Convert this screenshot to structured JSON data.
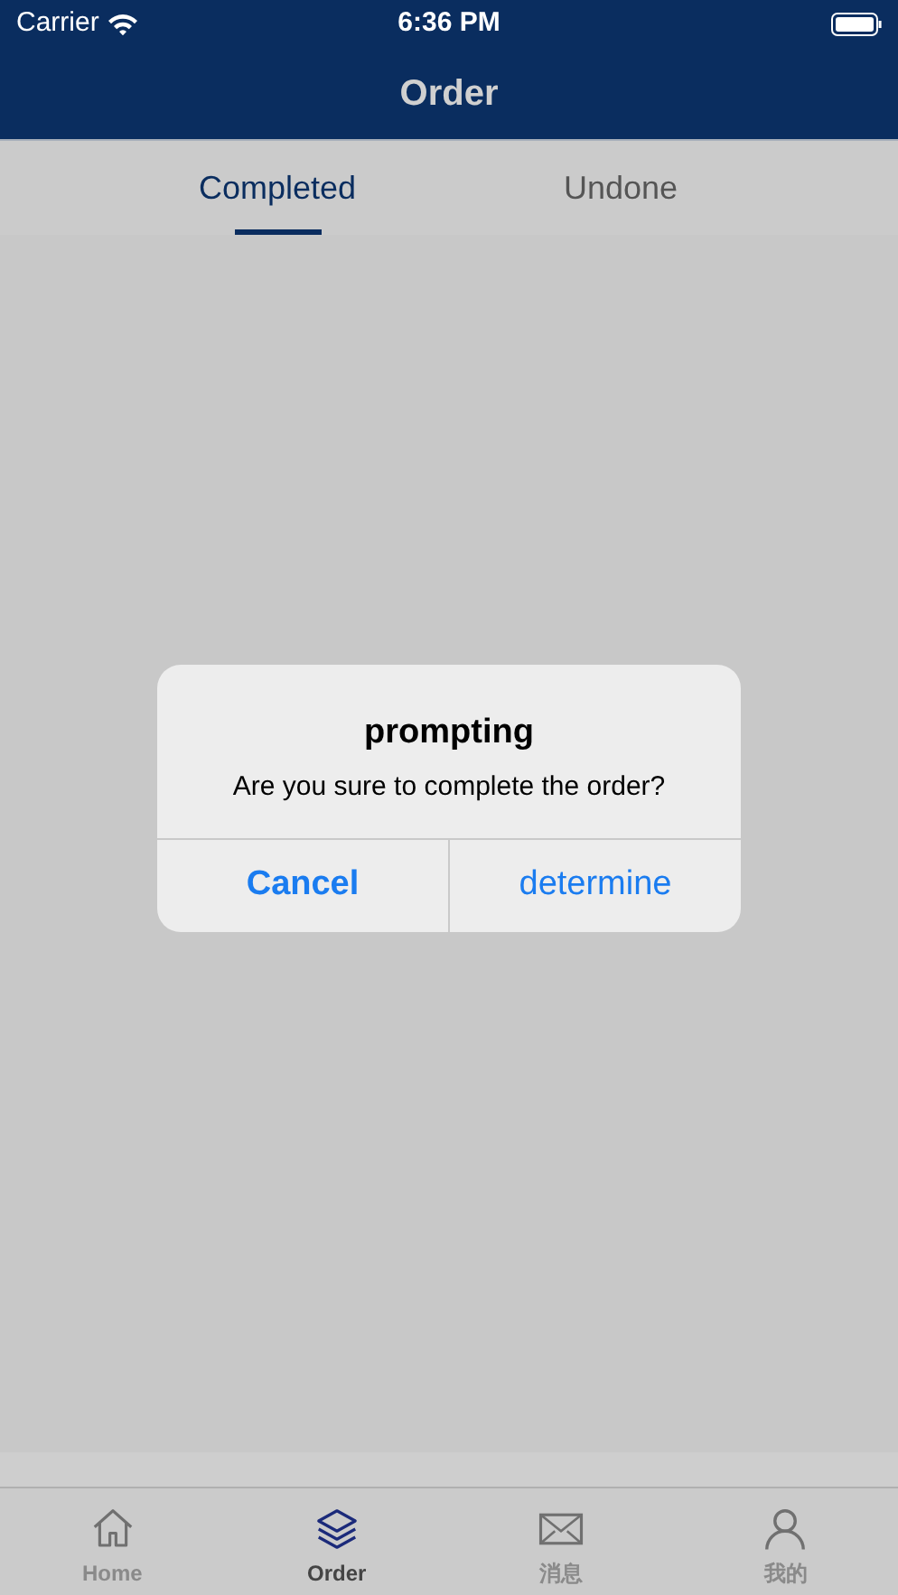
{
  "status_bar": {
    "carrier": "Carrier",
    "time": "6:36 PM"
  },
  "nav": {
    "title": "Order"
  },
  "tabs": [
    {
      "label": "Completed",
      "selected": true
    },
    {
      "label": "Undone",
      "selected": false
    }
  ],
  "dialog": {
    "title": "prompting",
    "message": "Are you sure to complete the order?",
    "buttons": [
      {
        "label": "Cancel",
        "kind": "cancel"
      },
      {
        "label": "determine",
        "kind": "default"
      }
    ]
  },
  "tab_bar": [
    {
      "label": "Home",
      "kind": "home",
      "selected": false
    },
    {
      "label": "Order",
      "kind": "layers",
      "selected": true
    },
    {
      "label": "消息",
      "kind": "mail",
      "selected": false
    },
    {
      "label": "我的",
      "kind": "person",
      "selected": false
    }
  ]
}
